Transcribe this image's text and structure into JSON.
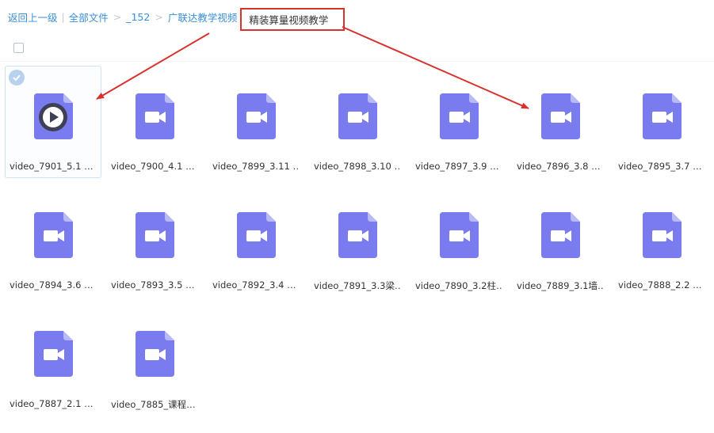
{
  "breadcrumb": {
    "back": "返回上一级",
    "all_files": "全部文件",
    "sep": ">",
    "level1": "_152",
    "level2": "广联达教学视频",
    "current": "精装算量视频教学"
  },
  "colors": {
    "file_icon": "#7b7bf0",
    "annotation": "#d8322f",
    "link": "#3b8fd6"
  },
  "files": [
    {
      "name": "video_7901_5.1 …",
      "icon": "video-file-icon",
      "selected": true
    },
    {
      "name": "video_7900_4.1 …",
      "icon": "video-file-icon"
    },
    {
      "name": "video_7899_3.11 …",
      "icon": "video-file-icon"
    },
    {
      "name": "video_7898_3.10 …",
      "icon": "video-file-icon"
    },
    {
      "name": "video_7897_3.9 …",
      "icon": "video-file-icon"
    },
    {
      "name": "video_7896_3.8 …",
      "icon": "video-file-icon"
    },
    {
      "name": "video_7895_3.7 …",
      "icon": "video-file-icon"
    },
    {
      "name": "video_7894_3.6 …",
      "icon": "video-file-icon"
    },
    {
      "name": "video_7893_3.5 …",
      "icon": "video-file-icon"
    },
    {
      "name": "video_7892_3.4 …",
      "icon": "video-file-icon"
    },
    {
      "name": "video_7891_3.3梁…",
      "icon": "video-file-icon"
    },
    {
      "name": "video_7890_3.2柱…",
      "icon": "video-file-icon"
    },
    {
      "name": "video_7889_3.1墙…",
      "icon": "video-file-icon"
    },
    {
      "name": "video_7888_2.2 …",
      "icon": "video-file-icon"
    },
    {
      "name": "video_7887_2.1 …",
      "icon": "video-file-icon"
    },
    {
      "name": "video_7885_课程…",
      "icon": "video-file-icon"
    }
  ]
}
